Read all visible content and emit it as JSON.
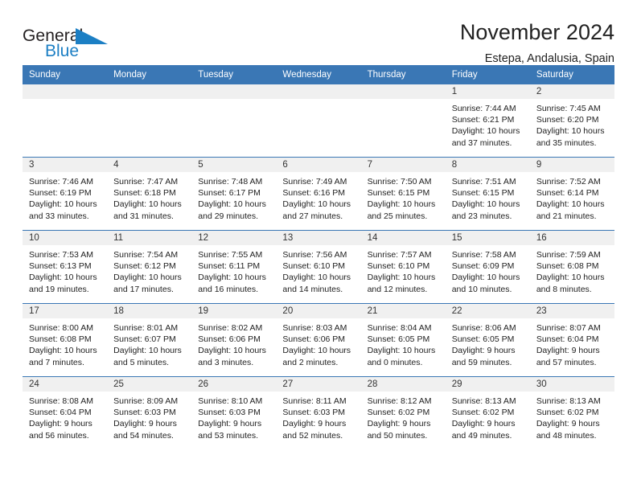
{
  "brand": {
    "name_part1": "General",
    "name_part2": "Blue",
    "flag_color": "#1c7fc4",
    "text_color": "#231f20"
  },
  "header": {
    "title": "November 2024",
    "subtitle": "Estepa, Andalusia, Spain",
    "accent_color": "#3a77b5"
  },
  "calendar": {
    "weekday_headers": [
      "Sunday",
      "Monday",
      "Tuesday",
      "Wednesday",
      "Thursday",
      "Friday",
      "Saturday"
    ],
    "labels": {
      "sunrise": "Sunrise:",
      "sunset": "Sunset:",
      "daylight": "Daylight:"
    },
    "weeks": [
      [
        {
          "day": ""
        },
        {
          "day": ""
        },
        {
          "day": ""
        },
        {
          "day": ""
        },
        {
          "day": ""
        },
        {
          "day": "1",
          "sunrise": "Sunrise: 7:44 AM",
          "sunset": "Sunset: 6:21 PM",
          "daylight": "Daylight: 10 hours and 37 minutes."
        },
        {
          "day": "2",
          "sunrise": "Sunrise: 7:45 AM",
          "sunset": "Sunset: 6:20 PM",
          "daylight": "Daylight: 10 hours and 35 minutes."
        }
      ],
      [
        {
          "day": "3",
          "sunrise": "Sunrise: 7:46 AM",
          "sunset": "Sunset: 6:19 PM",
          "daylight": "Daylight: 10 hours and 33 minutes."
        },
        {
          "day": "4",
          "sunrise": "Sunrise: 7:47 AM",
          "sunset": "Sunset: 6:18 PM",
          "daylight": "Daylight: 10 hours and 31 minutes."
        },
        {
          "day": "5",
          "sunrise": "Sunrise: 7:48 AM",
          "sunset": "Sunset: 6:17 PM",
          "daylight": "Daylight: 10 hours and 29 minutes."
        },
        {
          "day": "6",
          "sunrise": "Sunrise: 7:49 AM",
          "sunset": "Sunset: 6:16 PM",
          "daylight": "Daylight: 10 hours and 27 minutes."
        },
        {
          "day": "7",
          "sunrise": "Sunrise: 7:50 AM",
          "sunset": "Sunset: 6:15 PM",
          "daylight": "Daylight: 10 hours and 25 minutes."
        },
        {
          "day": "8",
          "sunrise": "Sunrise: 7:51 AM",
          "sunset": "Sunset: 6:15 PM",
          "daylight": "Daylight: 10 hours and 23 minutes."
        },
        {
          "day": "9",
          "sunrise": "Sunrise: 7:52 AM",
          "sunset": "Sunset: 6:14 PM",
          "daylight": "Daylight: 10 hours and 21 minutes."
        }
      ],
      [
        {
          "day": "10",
          "sunrise": "Sunrise: 7:53 AM",
          "sunset": "Sunset: 6:13 PM",
          "daylight": "Daylight: 10 hours and 19 minutes."
        },
        {
          "day": "11",
          "sunrise": "Sunrise: 7:54 AM",
          "sunset": "Sunset: 6:12 PM",
          "daylight": "Daylight: 10 hours and 17 minutes."
        },
        {
          "day": "12",
          "sunrise": "Sunrise: 7:55 AM",
          "sunset": "Sunset: 6:11 PM",
          "daylight": "Daylight: 10 hours and 16 minutes."
        },
        {
          "day": "13",
          "sunrise": "Sunrise: 7:56 AM",
          "sunset": "Sunset: 6:10 PM",
          "daylight": "Daylight: 10 hours and 14 minutes."
        },
        {
          "day": "14",
          "sunrise": "Sunrise: 7:57 AM",
          "sunset": "Sunset: 6:10 PM",
          "daylight": "Daylight: 10 hours and 12 minutes."
        },
        {
          "day": "15",
          "sunrise": "Sunrise: 7:58 AM",
          "sunset": "Sunset: 6:09 PM",
          "daylight": "Daylight: 10 hours and 10 minutes."
        },
        {
          "day": "16",
          "sunrise": "Sunrise: 7:59 AM",
          "sunset": "Sunset: 6:08 PM",
          "daylight": "Daylight: 10 hours and 8 minutes."
        }
      ],
      [
        {
          "day": "17",
          "sunrise": "Sunrise: 8:00 AM",
          "sunset": "Sunset: 6:08 PM",
          "daylight": "Daylight: 10 hours and 7 minutes."
        },
        {
          "day": "18",
          "sunrise": "Sunrise: 8:01 AM",
          "sunset": "Sunset: 6:07 PM",
          "daylight": "Daylight: 10 hours and 5 minutes."
        },
        {
          "day": "19",
          "sunrise": "Sunrise: 8:02 AM",
          "sunset": "Sunset: 6:06 PM",
          "daylight": "Daylight: 10 hours and 3 minutes."
        },
        {
          "day": "20",
          "sunrise": "Sunrise: 8:03 AM",
          "sunset": "Sunset: 6:06 PM",
          "daylight": "Daylight: 10 hours and 2 minutes."
        },
        {
          "day": "21",
          "sunrise": "Sunrise: 8:04 AM",
          "sunset": "Sunset: 6:05 PM",
          "daylight": "Daylight: 10 hours and 0 minutes."
        },
        {
          "day": "22",
          "sunrise": "Sunrise: 8:06 AM",
          "sunset": "Sunset: 6:05 PM",
          "daylight": "Daylight: 9 hours and 59 minutes."
        },
        {
          "day": "23",
          "sunrise": "Sunrise: 8:07 AM",
          "sunset": "Sunset: 6:04 PM",
          "daylight": "Daylight: 9 hours and 57 minutes."
        }
      ],
      [
        {
          "day": "24",
          "sunrise": "Sunrise: 8:08 AM",
          "sunset": "Sunset: 6:04 PM",
          "daylight": "Daylight: 9 hours and 56 minutes."
        },
        {
          "day": "25",
          "sunrise": "Sunrise: 8:09 AM",
          "sunset": "Sunset: 6:03 PM",
          "daylight": "Daylight: 9 hours and 54 minutes."
        },
        {
          "day": "26",
          "sunrise": "Sunrise: 8:10 AM",
          "sunset": "Sunset: 6:03 PM",
          "daylight": "Daylight: 9 hours and 53 minutes."
        },
        {
          "day": "27",
          "sunrise": "Sunrise: 8:11 AM",
          "sunset": "Sunset: 6:03 PM",
          "daylight": "Daylight: 9 hours and 52 minutes."
        },
        {
          "day": "28",
          "sunrise": "Sunrise: 8:12 AM",
          "sunset": "Sunset: 6:02 PM",
          "daylight": "Daylight: 9 hours and 50 minutes."
        },
        {
          "day": "29",
          "sunrise": "Sunrise: 8:13 AM",
          "sunset": "Sunset: 6:02 PM",
          "daylight": "Daylight: 9 hours and 49 minutes."
        },
        {
          "day": "30",
          "sunrise": "Sunrise: 8:13 AM",
          "sunset": "Sunset: 6:02 PM",
          "daylight": "Daylight: 9 hours and 48 minutes."
        }
      ]
    ]
  }
}
